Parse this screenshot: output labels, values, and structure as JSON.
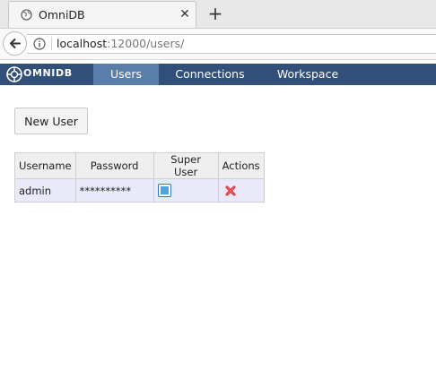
{
  "browser": {
    "tab_title": "OmniDB",
    "close_glyph": "✕",
    "new_tab_glyph": "+",
    "url_host": "localhost",
    "url_rest": ":12000/users/"
  },
  "app": {
    "logo_text": "OMNIDB",
    "menu": [
      {
        "label": "Users",
        "active": true
      },
      {
        "label": "Connections",
        "active": false
      },
      {
        "label": "Workspace",
        "active": false
      }
    ],
    "header_color": "#314f78",
    "active_menu_color": "#5a7eaa"
  },
  "users_page": {
    "new_user_label": "New User",
    "columns": [
      "Username",
      "Password",
      "Super User",
      "Actions"
    ],
    "rows": [
      {
        "username": "admin",
        "password": "**********",
        "super_user": true,
        "action_icon": "delete-icon"
      }
    ]
  }
}
